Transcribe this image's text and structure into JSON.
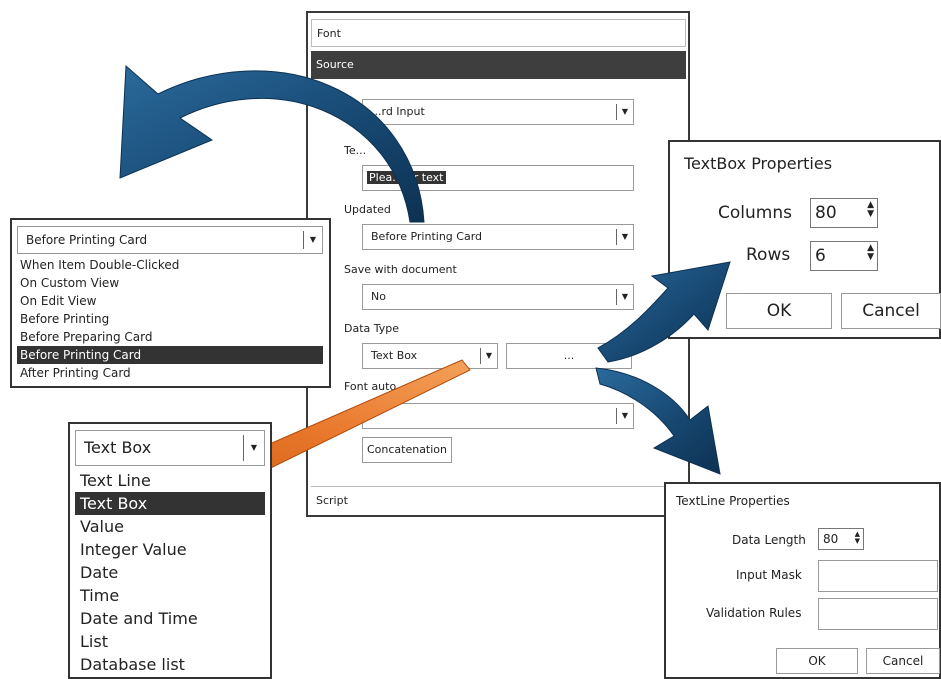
{
  "main_panel": {
    "sections": {
      "font": "Font",
      "source": "Source",
      "script": "Script"
    },
    "input_combo_value": "...rd Input",
    "text_label": "Te...",
    "text_value_visible": "Plea...ter text",
    "updated_label": "Updated",
    "updated_value": "Before Printing Card",
    "save_label": "Save with document",
    "save_value": "No",
    "datatype_label": "Data Type",
    "datatype_value": "Text Box",
    "ellipsis_button": "...",
    "font_auto_label": "Font auto ...",
    "concatenation_button": "Concatenation"
  },
  "trigger_dropdown": {
    "selected_value": "Before Printing Card",
    "options": [
      "When Item Double-Clicked",
      "On Custom View",
      "On Edit View",
      "Before Printing",
      "Before Preparing Card",
      "Before Printing Card",
      "After Printing Card"
    ],
    "highlighted_index": 5
  },
  "datatype_dropdown": {
    "selected_value": "Text Box",
    "options": [
      "Text Line",
      "Text Box",
      "Value",
      "Integer Value",
      "Date",
      "Time",
      "Date and Time",
      "List",
      "Database list"
    ],
    "highlighted_index": 1
  },
  "textbox_props": {
    "title": "TextBox  Properties",
    "columns_label": "Columns",
    "columns_value": "80",
    "rows_label": "Rows",
    "rows_value": "6",
    "ok_label": "OK",
    "cancel_label": "Cancel"
  },
  "textline_props": {
    "title": "TextLine  Properties",
    "data_length_label": "Data Length",
    "data_length_value": "80",
    "input_mask_label": "Input Mask",
    "input_mask_value": "",
    "validation_label": "Validation Rules",
    "validation_value": "",
    "ok_label": "OK",
    "cancel_label": "Cancel"
  },
  "icons": {
    "dropdown": "chevron-down-icon",
    "spin": "spin-updown-icon",
    "arrows": [
      "blue-curved-arrow-icon",
      "orange-arrow-icon"
    ]
  },
  "colors": {
    "selection": "#333333",
    "arrow_blue": "#1d4f7a",
    "arrow_orange": "#e07020"
  }
}
